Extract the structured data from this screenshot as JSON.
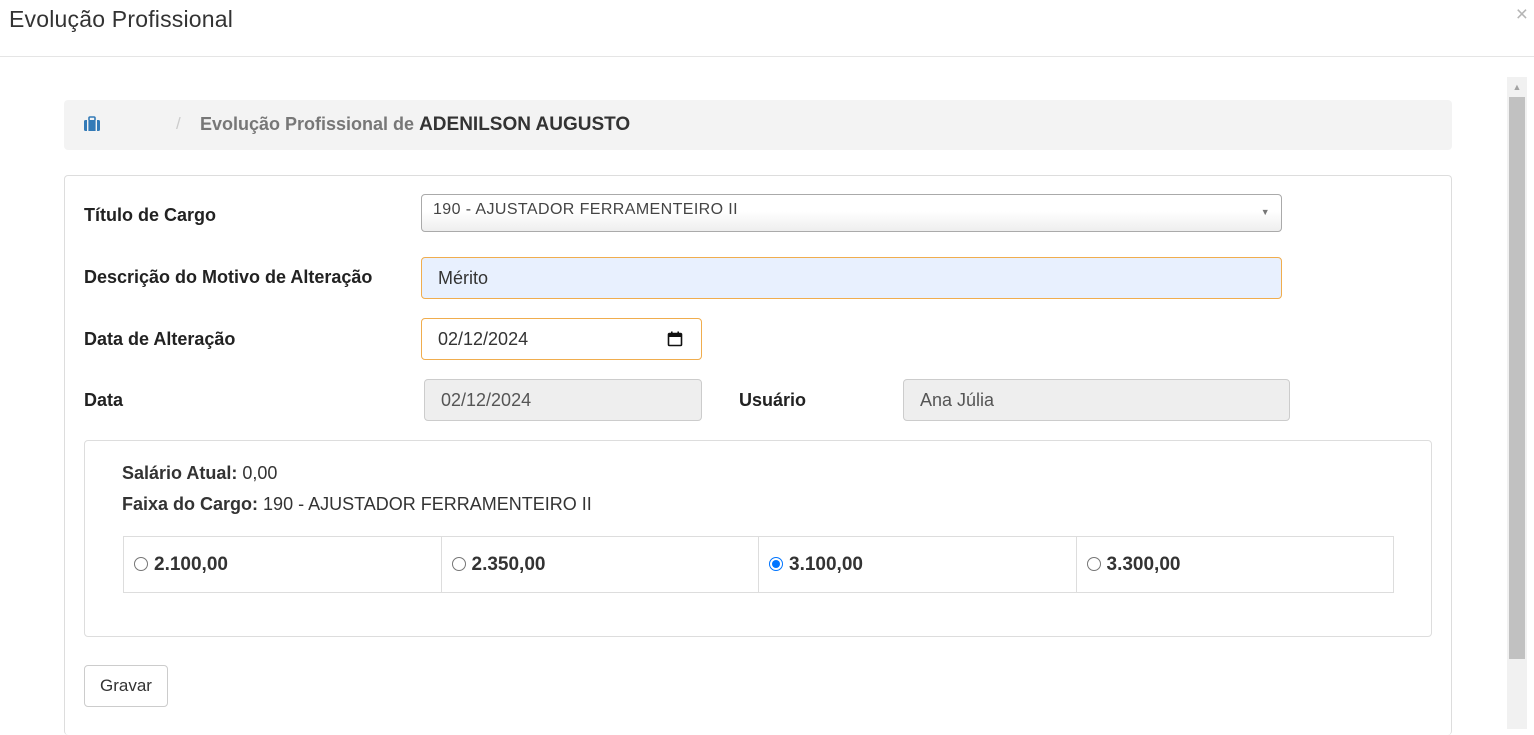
{
  "modal": {
    "title": "Evolução Profissional",
    "close_label": "×"
  },
  "breadcrumb": {
    "icon": "briefcase-icon",
    "separator": "/",
    "prefix": "Evolução Profissional de",
    "employee_name": "ADENILSON AUGUSTO"
  },
  "form": {
    "cargo_label": "Título de Cargo",
    "cargo_value": "190 - AJUSTADOR FERRAMENTEIRO II",
    "motivo_label": "Descrição do Motivo de Alteração",
    "motivo_value": "Mérito",
    "data_alteracao_label": "Data de Alteração",
    "data_alteracao_value": "02/12/2024",
    "data_label": "Data",
    "data_value": "02/12/2024",
    "usuario_label": "Usuário",
    "usuario_value": "Ana Júlia"
  },
  "salary": {
    "atual_label": "Salário Atual:",
    "atual_value": "0,00",
    "faixa_label": "Faixa do Cargo:",
    "faixa_value": "190 - AJUSTADOR FERRAMENTEIRO II",
    "options": [
      {
        "value": "2.100,00",
        "checked": false
      },
      {
        "value": "2.350,00",
        "checked": false
      },
      {
        "value": "3.100,00",
        "checked": true
      },
      {
        "value": "3.300,00",
        "checked": false
      }
    ]
  },
  "actions": {
    "save_label": "Gravar"
  },
  "colors": {
    "accent": "#0075ff",
    "focus_border": "#f0ad4e",
    "autofill_bg": "#e8f0fe",
    "readonly_bg": "#eeeeee",
    "breadcrumb_bg": "#f3f3f3"
  }
}
